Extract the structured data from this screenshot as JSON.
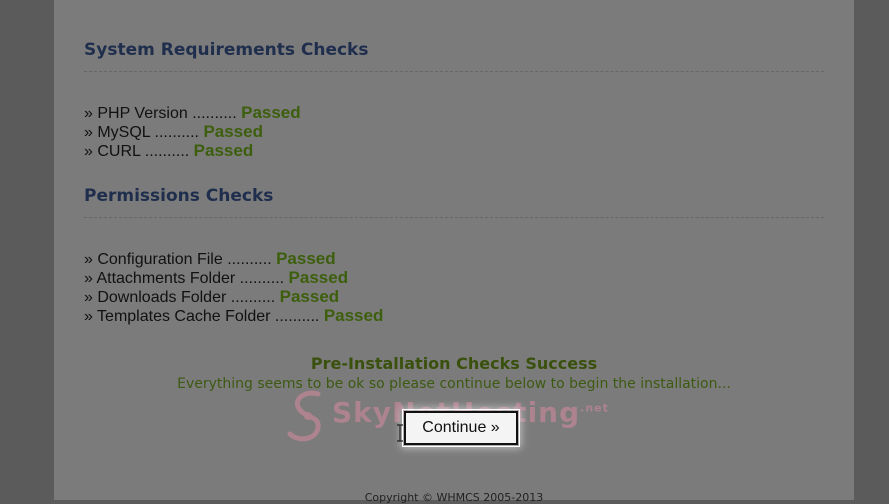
{
  "system_section": {
    "title": "System Requirements Checks",
    "items": [
      {
        "prefix": "» PHP Version .......... ",
        "status": "Passed"
      },
      {
        "prefix": "» MySQL .......... ",
        "status": "Passed"
      },
      {
        "prefix": "» CURL .......... ",
        "status": "Passed"
      }
    ]
  },
  "permissions_section": {
    "title": "Permissions Checks",
    "items": [
      {
        "prefix": "» Configuration File .......... ",
        "status": "Passed"
      },
      {
        "prefix": "» Attachments Folder .......... ",
        "status": "Passed"
      },
      {
        "prefix": "» Downloads Folder .......... ",
        "status": "Passed"
      },
      {
        "prefix": "» Templates Cache Folder .......... ",
        "status": "Passed"
      }
    ]
  },
  "success": {
    "title": "Pre-Installation Checks Success",
    "message": "Everything seems to be ok so please continue below to begin the installation..."
  },
  "continue_label": "Continue »",
  "watermark": {
    "text": "SkyNetHosting",
    "suffix": ".net",
    "icon": "s-logo-icon"
  },
  "footer": "Copyright © WHMCS 2005-2013",
  "colors": {
    "page_bg": "#5b5b5b",
    "panel_bg": "#7b7b7b",
    "heading": "#1f2e4d",
    "passed": "#3d5f0d"
  }
}
